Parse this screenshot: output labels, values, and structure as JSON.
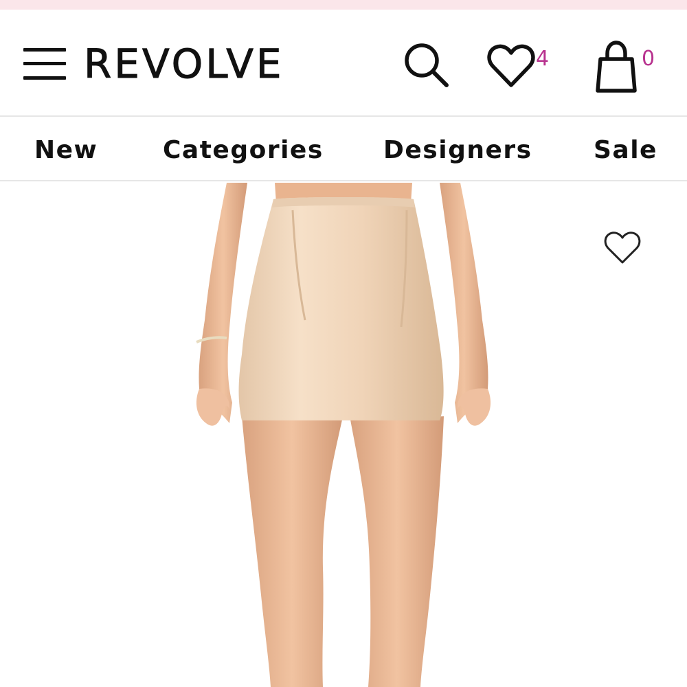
{
  "header": {
    "brand": "REVOLVE",
    "wishlist_count": "4",
    "bag_count": "0",
    "icons": [
      "menu-icon",
      "search-icon",
      "heart-icon",
      "shopping-bag-icon"
    ],
    "accent_color": "#b8338f",
    "strip_color": "#fbe6ea"
  },
  "nav": {
    "items": [
      {
        "label": "New"
      },
      {
        "label": "Categories"
      },
      {
        "label": "Designers"
      },
      {
        "label": "Sale"
      }
    ]
  },
  "product": {
    "image_subject": "model wearing beige satin mini skirt",
    "favorite_icon": "heart-outline-icon"
  }
}
